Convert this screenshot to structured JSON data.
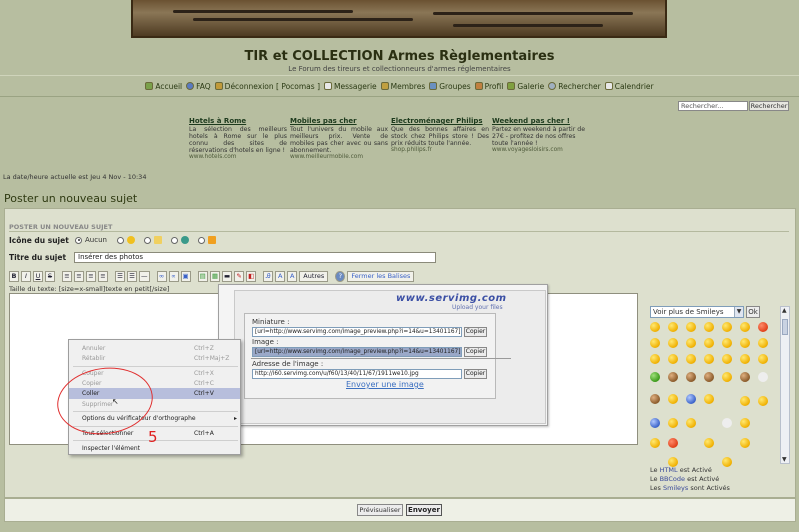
{
  "site": {
    "title": "TIR et COLLECTION Armes Règlementaires",
    "description": "Le Forum des tireurs et collectionneurs d'armes réglementaires"
  },
  "nav": [
    {
      "label": "Accueil",
      "icon": "home-icon",
      "color": "#7aa04a"
    },
    {
      "label": "FAQ",
      "icon": "faq-icon",
      "color": "#5a7ac0"
    },
    {
      "label": "Déconnexion [ Pocomas ]",
      "icon": "logout-icon",
      "color": "#c09a3a"
    },
    {
      "label": "Messagerie",
      "icon": "mail-icon",
      "color": "#e8e8e8"
    },
    {
      "label": "Membres",
      "icon": "members-icon",
      "color": "#c0a040"
    },
    {
      "label": "Groupes",
      "icon": "groups-icon",
      "color": "#6a90c0"
    },
    {
      "label": "Profil",
      "icon": "profile-icon",
      "color": "#c08040"
    },
    {
      "label": "Galerie",
      "icon": "gallery-icon",
      "color": "#80a040"
    },
    {
      "label": "Rechercher",
      "icon": "search-icon",
      "color": "#a0b0c0"
    },
    {
      "label": "Calendrier",
      "icon": "calendar-icon",
      "color": "#e8e8e8"
    }
  ],
  "search": {
    "placeholder": "Rechercher...",
    "button": "Rechercher"
  },
  "ads": [
    {
      "title": "Hotels à Rome",
      "text": "La sélection des meilleurs hotels à Rome sur le plus connu des sites de réservations d'hotels en ligne !",
      "url": "www.hotels.com"
    },
    {
      "title": "Mobiles pas cher",
      "text": "Tout l'univers du mobile aux meilleurs prix. Vente de mobiles pas cher avec ou sans abonnement.",
      "url": "www.meilleurmobile.com"
    },
    {
      "title": "Electroménager Philips",
      "text": "Que des bonnes affaires en stock chez Philips store ! Des prix réduits toute l'année.",
      "url": "shop.philips.fr"
    },
    {
      "title": "Weekend pas cher !",
      "text": "Partez en weekend à partir de 27€ - profitez de nos offres toute l'année !",
      "url": "www.voyagesloisirs.com"
    }
  ],
  "current_date": "La date/heure actuelle est Jeu 4 Nov - 10:34",
  "page_title": "Poster un nouveau sujet",
  "form": {
    "header": "POSTER UN NOUVEAU SUJET",
    "icon_label": "Icône du sujet",
    "icon_none": "Aucun",
    "subject_label": "Titre du sujet",
    "subject_value": "Insérer des photos",
    "font_size_hint": "Taille du texte: [size=x-small]texte en petit[/size]",
    "toolbar": {
      "bold": "B",
      "italic": "I",
      "underline": "U",
      "strike": "S",
      "others": "Autres",
      "help": "?",
      "close_tags": "Fermer les Balises"
    }
  },
  "servimg": {
    "logo": "www.servimg.com",
    "slogan": "Upload your files",
    "thumb_label": "Miniature :",
    "thumb_value": "[url=http://www.servimg.com/image_preview.php?i=14&u=13401167][im",
    "image_label": "Image :",
    "image_value": "[url=http://www.servimg.com/image_preview.php?i=14&u=13401167][im",
    "address_label": "Adresse de l'image :",
    "address_value": "http://i60.servimg.com/u/f60/13/40/11/67/1911we10.jpg",
    "copy_button": "Copier",
    "send_link": "Envoyer une image"
  },
  "context_menu": {
    "undo": "Annuler",
    "undo_sc": "Ctrl+Z",
    "redo": "Rétablir",
    "redo_sc": "Ctrl+Maj+Z",
    "cut": "Couper",
    "cut_sc": "Ctrl+X",
    "copy": "Copier",
    "copy_sc": "Ctrl+C",
    "paste": "Coller",
    "paste_sc": "Ctrl+V",
    "delete": "Supprimer",
    "spell": "Options du vérificateur d'orthographe",
    "select_all": "Tout sélectionner",
    "select_all_sc": "Ctrl+A",
    "inspect": "Inspecter l'élément"
  },
  "annotation": {
    "number": "5",
    "color": "#e02020"
  },
  "smileys": {
    "select_value": "Voir plus de Smileys",
    "ok": "Ok",
    "status": [
      {
        "prefix": "Le ",
        "key": "HTML",
        "suffix": " est Activé"
      },
      {
        "prefix": "Le ",
        "key": "BBCode",
        "suffix": " est Activé"
      },
      {
        "prefix": "Les ",
        "key": "Smileys",
        "suffix": " sont Activés"
      }
    ]
  },
  "buttons": {
    "preview": "Prévisualiser",
    "submit": "Envoyer"
  }
}
